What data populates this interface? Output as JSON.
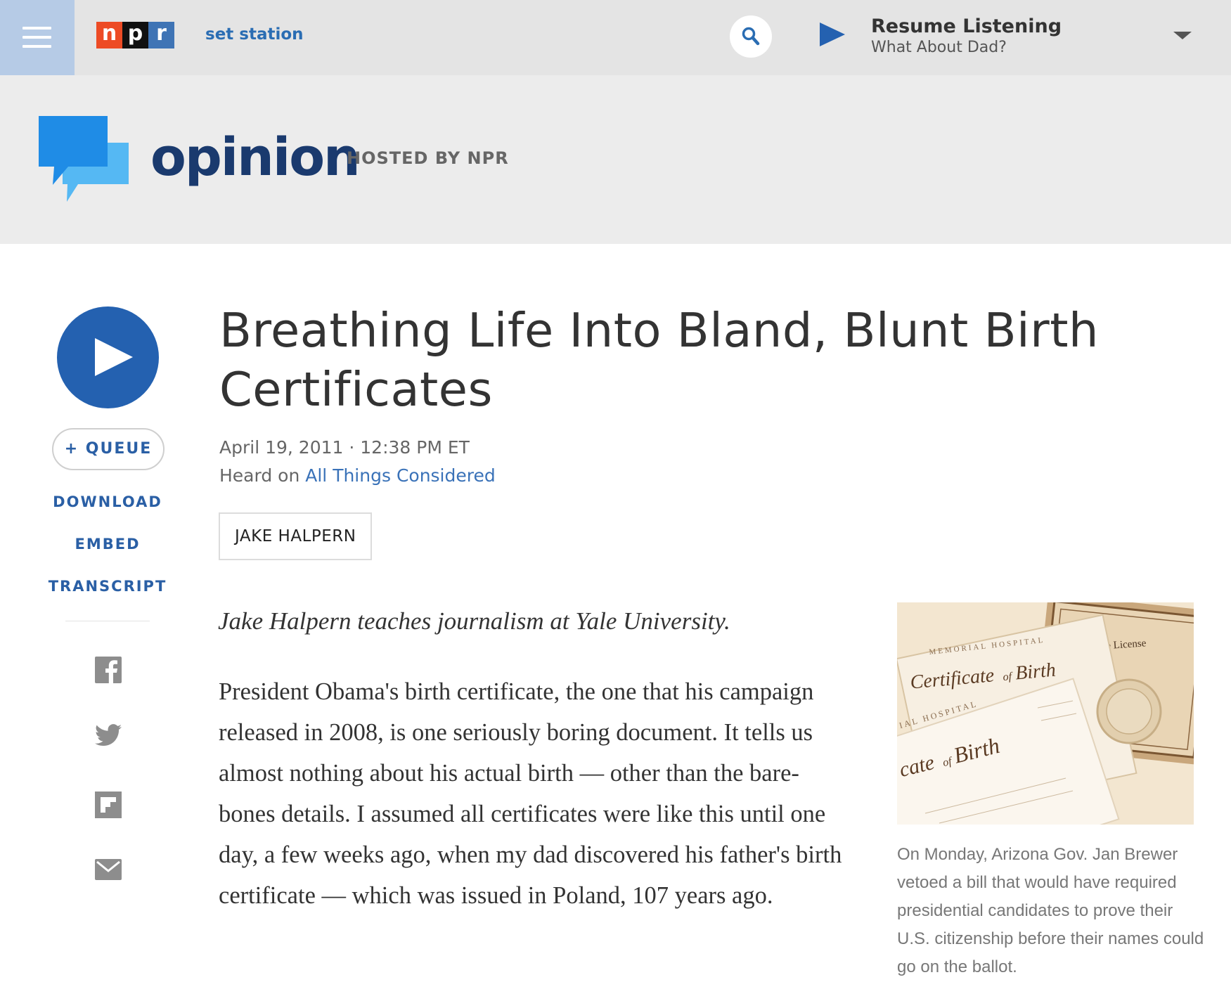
{
  "nav": {
    "logo_letters": [
      "n",
      "p",
      "r"
    ],
    "set_station": "set station",
    "resume_title": "Resume Listening",
    "resume_subtitle": "What About Dad?"
  },
  "program": {
    "name": "opinion",
    "hosted_by": "HOSTED BY NPR"
  },
  "rail": {
    "queue_label": "QUEUE",
    "download_label": "DOWNLOAD",
    "embed_label": "EMBED",
    "transcript_label": "TRANSCRIPT",
    "share_icons": [
      "facebook-icon",
      "twitter-icon",
      "flipboard-icon",
      "email-icon"
    ]
  },
  "article": {
    "headline": "Breathing Life Into Bland, Blunt Birth Certificates",
    "date": "April 19, 2011 · 12:38 PM ET",
    "heard_on_prefix": "Heard on ",
    "heard_on_show": "All Things Considered",
    "byline": "JAKE HALPERN",
    "intro": "Jake Halpern teaches journalism at Yale University.",
    "paragraph_1": "President Obama's birth certificate, the one that his campaign released in 2008, is one seriously boring document. It tells us almost nothing about his actual birth — other than the bare-bones details. I assumed all certificates were like this until one day, a few weeks ago, when my dad discovered his father's birth certificate — which was issued in Poland, 107 years ago."
  },
  "figure": {
    "caption": "On Monday, Arizona Gov. Jan Brewer vetoed a bill that would have required presidential candidates to prove their U.S. citizenship before their names could go on the ballot.",
    "image_text": {
      "hospital_1": "MEMORIAL HOSPITAL",
      "certificate_1_a": "Certificate",
      "certificate_1_of": "of",
      "certificate_1_b": "Birth",
      "hospital_2": "IAL HOSPITAL",
      "certificate_2_a": "cate",
      "certificate_2_of": "of",
      "certificate_2_b": "Birth",
      "license": "riage License"
    }
  },
  "colors": {
    "nav_bg": "#e4e4e4",
    "menu_bg": "#b6cbe6",
    "header_bg": "#ececec",
    "npr_red": "#ed4b25",
    "npr_black": "#111111",
    "npr_blue": "#3f74b5",
    "link_blue": "#2a5fa5",
    "play_blue": "#2461b0",
    "opinion_navy": "#1a3a6e",
    "bubble_blue": "#1f8ce6",
    "bubble_light": "#55b8f3"
  }
}
